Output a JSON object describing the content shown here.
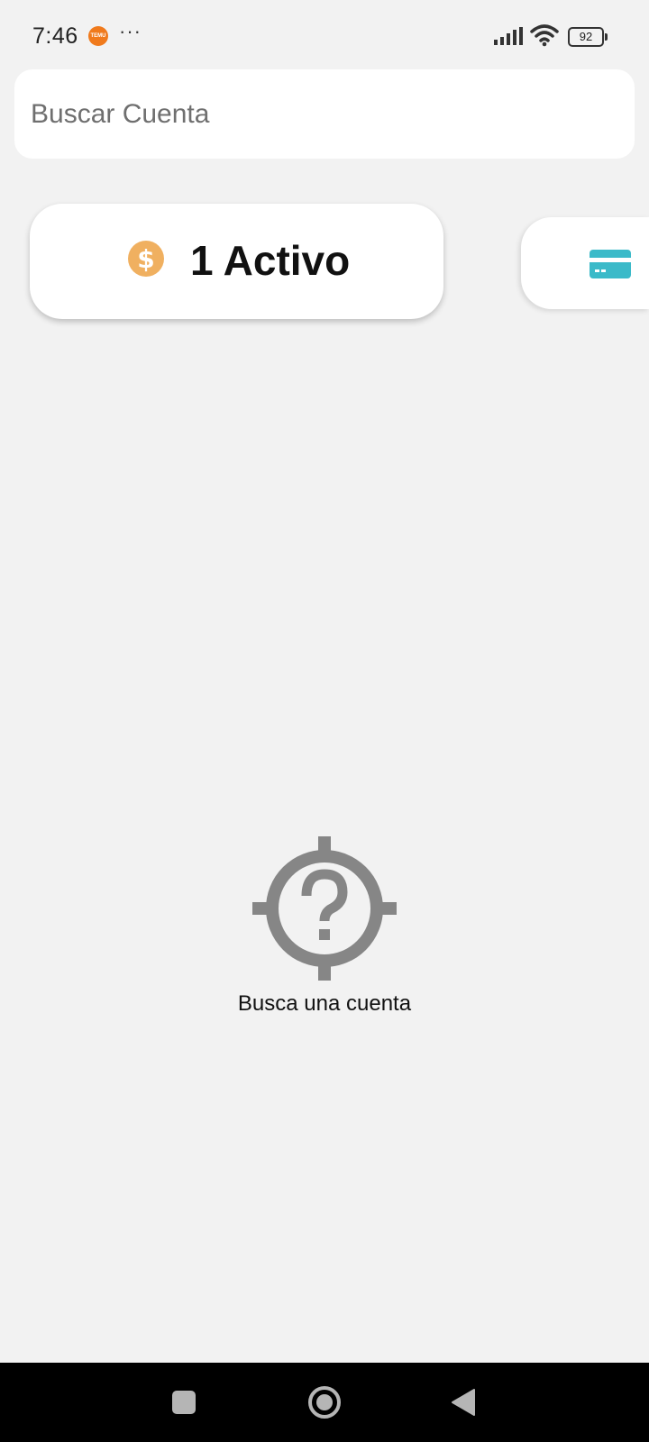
{
  "status_bar": {
    "time": "7:46",
    "app_badge": "TEMU",
    "more": "···",
    "battery": "92",
    "icons": [
      "temu-app-icon",
      "more-icon",
      "signal-icon",
      "wifi-icon",
      "battery-icon"
    ]
  },
  "search": {
    "placeholder": "Buscar Cuenta",
    "value": "",
    "icon": "none"
  },
  "cards": [
    {
      "label": "1 Activo",
      "icon": "dollar-coin-icon",
      "icon_color": "#f0b060"
    },
    {
      "label": "",
      "icon": "credit-card-icon",
      "icon_color": "#3bbac9"
    }
  ],
  "empty_state": {
    "icon": "target-question-icon",
    "icon_color": "#868686",
    "message": "Busca una cuenta"
  },
  "nav_bar": {
    "items": [
      "recent-apps-button",
      "home-button",
      "back-button"
    ]
  },
  "colors": {
    "background": "#f2f2f2",
    "surface": "#ffffff",
    "accent_orange": "#f0b060",
    "accent_teal": "#3bbac9"
  }
}
